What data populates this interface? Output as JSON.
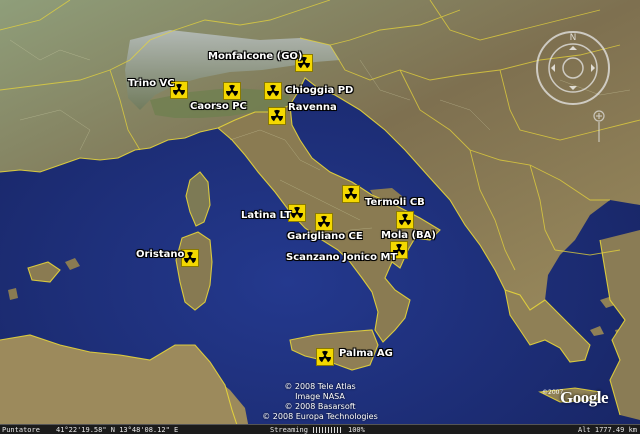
{
  "sites": [
    {
      "id": "trino",
      "label": "Trino VC"
    },
    {
      "id": "caorso",
      "label": "Caorso PC"
    },
    {
      "id": "monfalcone",
      "label": "Monfalcone (GO)"
    },
    {
      "id": "chioggia",
      "label": "Chioggia PD"
    },
    {
      "id": "ravenna",
      "label": "Ravenna"
    },
    {
      "id": "termoli",
      "label": "Termoli CB"
    },
    {
      "id": "latina",
      "label": "Latina LT"
    },
    {
      "id": "garigliano",
      "label": "Garigliano CE"
    },
    {
      "id": "mola",
      "label": "Mola (BA)"
    },
    {
      "id": "scanzano",
      "label": "Scanzano Jonico MT"
    },
    {
      "id": "oristano",
      "label": "Oristano"
    },
    {
      "id": "palma",
      "label": "Palma AG"
    }
  ],
  "marker_icon": "radiation-hazard-icon",
  "marker_color": "#f4d800",
  "attribution": {
    "line1": "© 2008 Tele Atlas",
    "line2": "Image NASA",
    "line3": "© 2008 Basarsoft",
    "line4": "© 2008 Europa Technologies"
  },
  "status_bar": {
    "pointer_label": "Puntatore",
    "pointer_coords": "41°22'19.58\" N    13°48'08.12\" E",
    "streaming_label": "Streaming",
    "streaming_percent": "100%",
    "streaming_fraction": 1.0,
    "altitude": "Alt  1777.49 km"
  },
  "branding": {
    "logo": "Google",
    "copyright": "©2007"
  },
  "colors": {
    "sea": "#1b2b7a",
    "land": "#8c7a55",
    "border": "#e8d63a"
  }
}
